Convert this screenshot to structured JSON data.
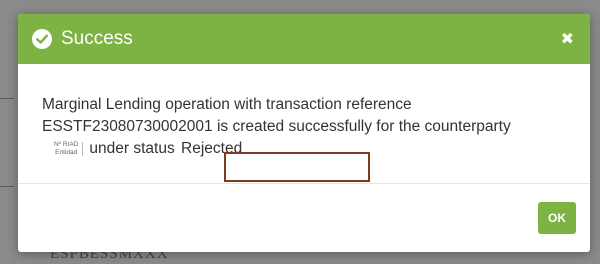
{
  "backdrop": {
    "text": "ESPBESSMXXX"
  },
  "dialog": {
    "title": "Success",
    "close_symbol": "✖",
    "message": {
      "line1": "Marginal Lending operation with transaction reference",
      "line2": "ESSTF23080730002001 is created successfully for the counterparty",
      "riad_label_1": "Nº RIAD",
      "riad_label_2": "Entidad",
      "line3_prefix": "under status",
      "status": "Rejected"
    },
    "ok_label": "OK"
  },
  "colors": {
    "header": "#7cb342",
    "button": "#7cb342",
    "highlight": "#7a3b1e"
  },
  "icons": {
    "header": "check-circle-icon",
    "close": "close-icon"
  }
}
